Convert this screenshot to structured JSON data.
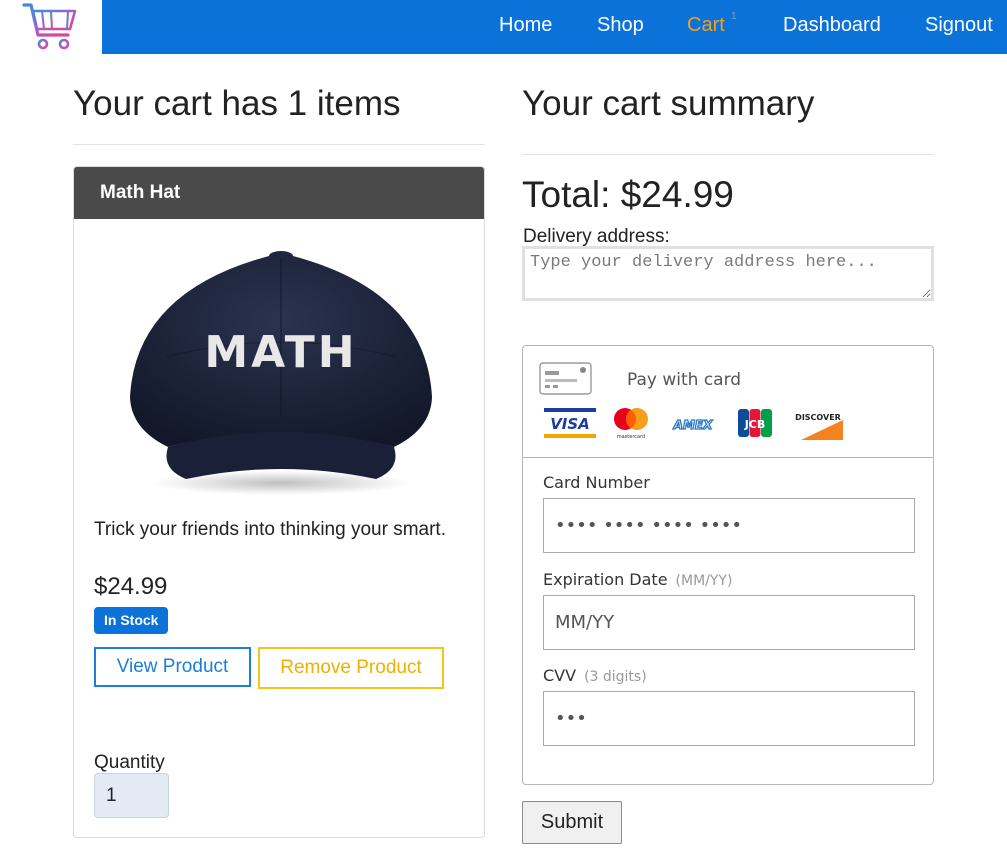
{
  "nav": {
    "items": [
      {
        "label": "Home"
      },
      {
        "label": "Shop"
      },
      {
        "label": "Cart",
        "badge": "1"
      },
      {
        "label": "Dashboard"
      },
      {
        "label": "Signout"
      }
    ],
    "active": "Cart",
    "colors": {
      "bar": "#0b72d9",
      "active": "#f0a020"
    }
  },
  "cart": {
    "title": "Your cart has 1 items",
    "item": {
      "name": "Math Hat",
      "image_text": "MATH",
      "description": "Trick your friends into thinking your smart.",
      "price": "$24.99",
      "stock": "In Stock",
      "view_label": "View Product",
      "remove_label": "Remove Product",
      "quantity_label": "Quantity",
      "quantity": "1"
    }
  },
  "summary": {
    "title": "Your cart summary",
    "total": "Total: $24.99",
    "delivery_label": "Delivery address:",
    "delivery_placeholder": "Type your delivery address here...",
    "payment": {
      "heading": "Pay with card",
      "brands": [
        "VISA",
        "mastercard",
        "AMEX",
        "JCB",
        "DISCOVER"
      ],
      "card_number_label": "Card Number",
      "card_number_placeholder": "•••• •••• •••• ••••",
      "expiry_label": "Expiration Date",
      "expiry_hint": "(MM/YY)",
      "expiry_placeholder": "MM/YY",
      "cvv_label": "CVV",
      "cvv_hint": "(3 digits)",
      "cvv_placeholder": "•••"
    },
    "submit_label": "Submit"
  }
}
